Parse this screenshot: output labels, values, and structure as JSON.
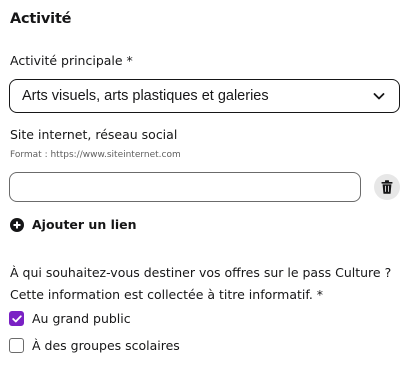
{
  "section": {
    "title": "Activité"
  },
  "main_activity": {
    "label": "Activité principale *",
    "selected_value": "Arts visuels, arts plastiques et galeries"
  },
  "website": {
    "label": "Site internet, réseau social",
    "help": "Format : https://www.siteinternet.com",
    "value": "",
    "add_link_label": "Ajouter un lien"
  },
  "audience": {
    "question_line1": "À qui souhaitez-vous destiner vos offres sur le pass Culture ?",
    "question_line2": "Cette information est collectée à titre informatif. *",
    "options": [
      {
        "label": "Au grand public",
        "checked": true
      },
      {
        "label": "À des groupes scolaires",
        "checked": false
      }
    ]
  },
  "colors": {
    "accent": "#7a21c4",
    "text": "#161617",
    "trash_bg": "#e7e7e7"
  },
  "icons": {
    "select": "chevron-down-icon",
    "delete": "trash-icon",
    "add": "plus-circle-icon",
    "check": "check-icon"
  }
}
